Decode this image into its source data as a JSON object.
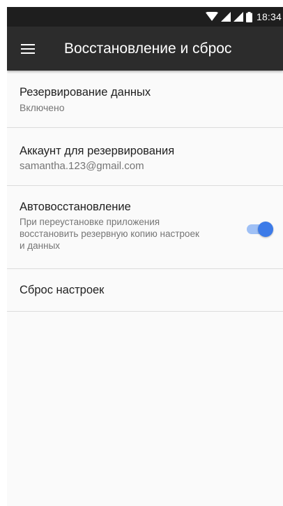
{
  "status_bar": {
    "time": "18:34"
  },
  "toolbar": {
    "title": "Восстановление и сброс",
    "menu_icon": "hamburger-menu-icon"
  },
  "settings": [
    {
      "title": "Резервирование данных",
      "subtitle": "Включено"
    },
    {
      "title": "Аккаунт для резервирования",
      "subtitle": "samantha.123@gmail.com"
    },
    {
      "title": "Автовосстановление",
      "subtitle": "При переустановке приложения восстановить резервную копию настроек и данных",
      "toggle_on": true
    },
    {
      "title": "Сброс настроек"
    }
  ],
  "colors": {
    "toolbar": "#2c2c2c",
    "status_bar": "#1e1e1e",
    "accent": "#3d7be8"
  }
}
